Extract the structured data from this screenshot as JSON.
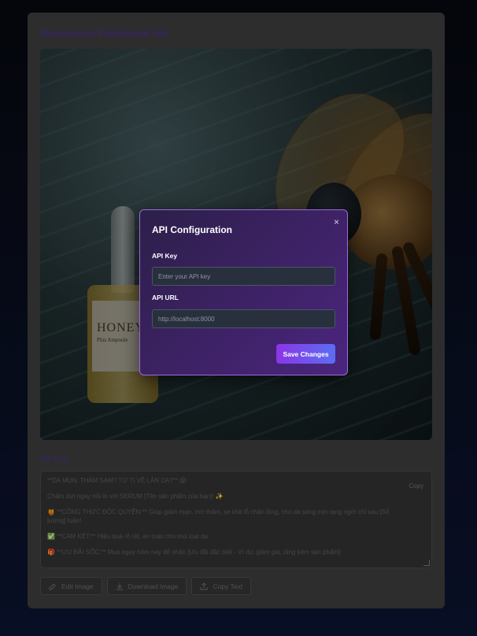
{
  "card": {
    "title": "Generated Facebook Ad"
  },
  "hero": {
    "alt": "Honey serum bottle next to a bee",
    "bottle_brand": "HONEY",
    "bottle_sub": "Plus Ampoule"
  },
  "modal": {
    "title": "API Configuration",
    "close_glyph": "×",
    "api_key_label": "API Key",
    "api_key_placeholder": "Enter your API key",
    "api_key_value": "",
    "api_url_label": "API URL",
    "api_url_placeholder": "http://localhost:8000",
    "api_url_value": "",
    "save_label": "Save Changes"
  },
  "ad_text": {
    "label": "Ad Text",
    "copy_label": "Copy",
    "paragraphs": [
      "**DA MỤN, THÂM SẠM? TỪ TI VỀ LÀN DA?** 😱",
      "Chấm dứt ngay nỗi lo với SERUM [Tên sản phẩm của bạn]! ✨",
      "🍯 **CÔNG THỨC ĐỘC QUYỀN:** Giúp giảm mụn, mờ thâm, se khít lỗ chân lông, cho da sáng mịn rạng ngời chỉ sau [Số lượng] tuần!",
      "✅ **CAM KẾT:** Hiệu quả rõ rệt, an toàn cho mọi loại da.",
      "🎁 **ƯU ĐÃI SỐC:** Mua ngay hôm nay để nhận [Ưu đãi đặc biệt - Ví dụ: giảm giá, tặng kèm sản phẩm]"
    ]
  },
  "actions": {
    "edit_label": "Edit Image",
    "download_label": "Download Image",
    "copy_label": "Copy Text"
  },
  "colors": {
    "accent": "#4a2f7e",
    "modal_border": "#9b6ad8",
    "button_start": "#8b35e6",
    "button_end": "#5b6ef2"
  }
}
